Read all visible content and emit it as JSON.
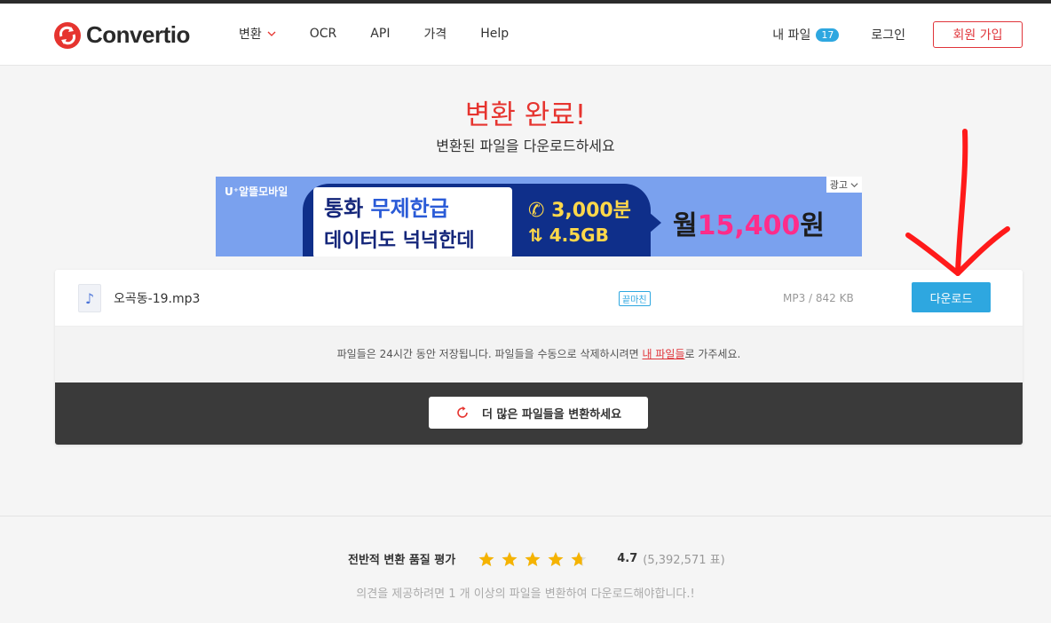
{
  "brand": {
    "name": "Convertio"
  },
  "nav": {
    "items": [
      {
        "label": "변환",
        "dropdown": true
      },
      {
        "label": "OCR"
      },
      {
        "label": "API"
      },
      {
        "label": "가격"
      },
      {
        "label": "Help"
      }
    ],
    "my_files_label": "내 파일",
    "my_files_count": "17",
    "login_label": "로그인",
    "signup_label": "회원 가입"
  },
  "hero": {
    "title": "변환 완료!",
    "subtitle": "변환된 파일을 다운로드하세요"
  },
  "ad": {
    "brand": "U⁺알뜰모바일",
    "line1_prefix": "통화 ",
    "line1_highlight": "무제한급",
    "line2": "데이터도 넉넉한데",
    "minutes": "3,000분",
    "data": "4.5GB",
    "price_prefix": "월",
    "price_value": "15,400",
    "price_suffix": "원",
    "tag": "광고"
  },
  "file": {
    "name": "오곡동-19.mp3",
    "status": "끝마친",
    "meta": "MP3 / 842 KB",
    "download_label": "다운로드"
  },
  "note": {
    "text_before": "파일들은 24시간 동안 저장됩니다. 파일들을 수동으로 삭제하시려면 ",
    "link": "내 파일들",
    "text_after": "로 가주세요."
  },
  "more": {
    "label": "더 많은 파일들을 변환하세요"
  },
  "rating": {
    "label": "전반적 변환 품질 평가",
    "stars": 4.7,
    "score": "4.7",
    "votes": "(5,392,571 표)",
    "feedback": "의견을 제공하려면 1 개 이상의 파일을 변환하여 다운로드해야합니다.!"
  },
  "colors": {
    "brand_red": "#e6342f",
    "accent_blue": "#2ea7e0",
    "star_gold": "#f5b301",
    "annotation_red": "#ff1a1a"
  }
}
